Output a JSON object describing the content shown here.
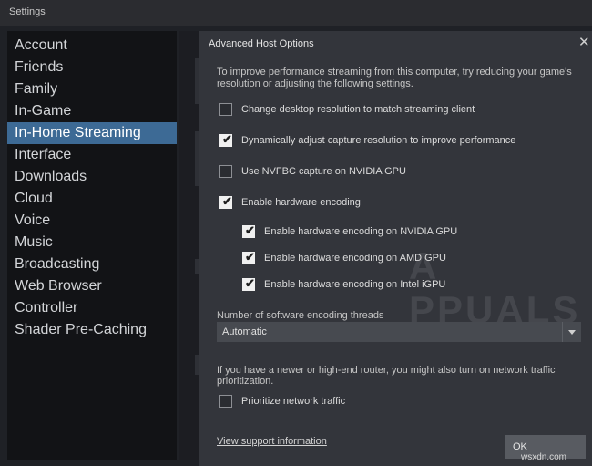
{
  "window": {
    "title": "Settings"
  },
  "sidebar": {
    "items": [
      {
        "label": "Account"
      },
      {
        "label": "Friends"
      },
      {
        "label": "Family"
      },
      {
        "label": "In-Game"
      },
      {
        "label": "In-Home Streaming",
        "active": true
      },
      {
        "label": "Interface"
      },
      {
        "label": "Downloads"
      },
      {
        "label": "Cloud"
      },
      {
        "label": "Voice"
      },
      {
        "label": "Music"
      },
      {
        "label": "Broadcasting"
      },
      {
        "label": "Web Browser"
      },
      {
        "label": "Controller"
      },
      {
        "label": "Shader Pre-Caching"
      }
    ]
  },
  "dialog": {
    "title": "Advanced Host Options",
    "description": "To improve performance streaming from this computer, try reducing your game's resolution or adjusting the following settings.",
    "options": [
      {
        "label": "Change desktop resolution to match streaming client",
        "checked": false
      },
      {
        "label": "Dynamically adjust capture resolution to improve performance",
        "checked": true
      },
      {
        "label": "Use NVFBC capture on NVIDIA GPU",
        "checked": false
      },
      {
        "label": "Enable hardware encoding",
        "checked": true
      },
      {
        "label": "Enable hardware encoding on NVIDIA GPU",
        "checked": true
      },
      {
        "label": "Enable hardware encoding on AMD GPU",
        "checked": true
      },
      {
        "label": "Enable hardware encoding on Intel iGPU",
        "checked": true
      }
    ],
    "threads_label": "Number of software encoding threads",
    "threads_value": "Automatic",
    "router_text": "If you have a newer or high-end router, you might also turn on network traffic prioritization.",
    "prioritize": {
      "label": "Prioritize network traffic",
      "checked": false
    },
    "support_link": "View support information",
    "ok_label": "OK"
  },
  "watermark": {
    "logo_text": "APPUALS",
    "site": "wsxdn.com"
  }
}
